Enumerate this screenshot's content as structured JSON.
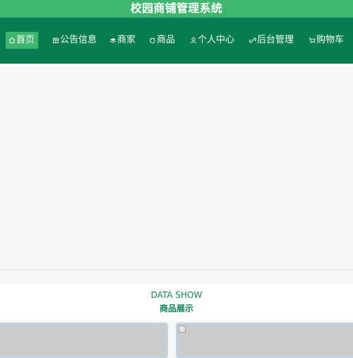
{
  "header": {
    "title": "校园商铺管理系统"
  },
  "nav": {
    "items": [
      {
        "label": "首页",
        "icon": "home-icon",
        "active": true
      },
      {
        "label": "公告信息",
        "icon": "notice-icon"
      },
      {
        "label": "商家",
        "icon": "layers-icon"
      },
      {
        "label": "商品",
        "icon": "goods-icon"
      },
      {
        "label": "个人中心",
        "icon": "user-icon"
      },
      {
        "label": "后台管理",
        "icon": "link-icon"
      },
      {
        "label": "购物车",
        "icon": "cart-icon"
      }
    ]
  },
  "data_section": {
    "title": "DATA SHOW",
    "subtitle": "商品展示"
  },
  "colors": {
    "topbar": "#3fb66d",
    "navbar": "#067e52",
    "active_tab": "#3fb66d",
    "accent_text": "#0a8456"
  }
}
